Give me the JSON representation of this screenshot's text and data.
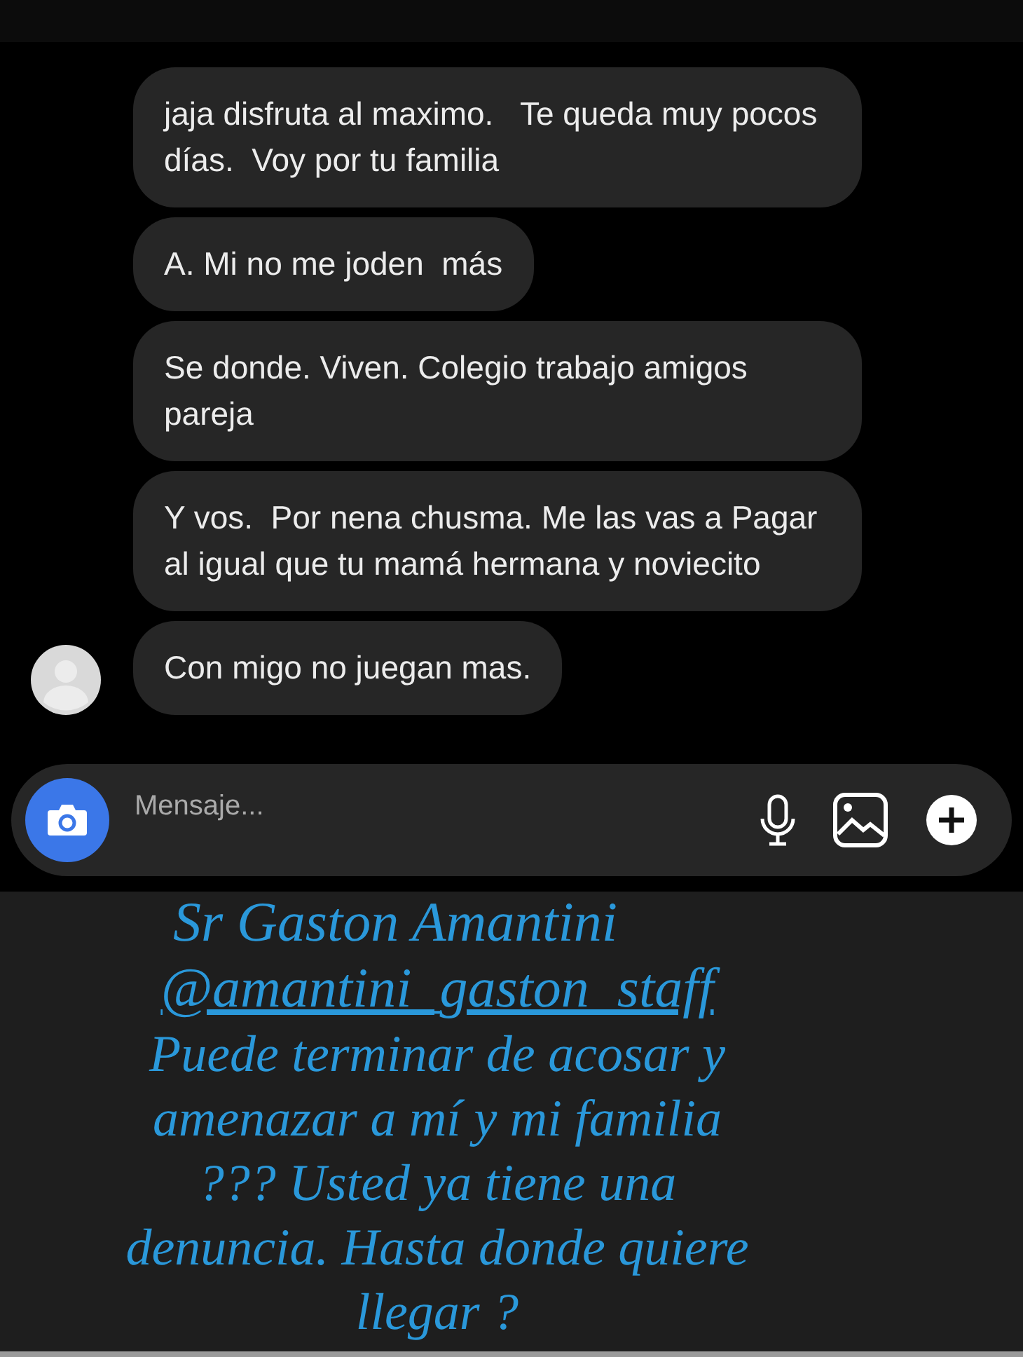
{
  "messages": [
    {
      "text": "jaja disfruta al maximo.   Te queda muy pocos días.  Voy por tu familia",
      "avatar": false
    },
    {
      "text": "A. Mi no me joden  más",
      "avatar": false
    },
    {
      "text": "Se donde. Viven. Colegio trabajo amigos pareja",
      "avatar": false
    },
    {
      "text": "Y vos.  Por nena chusma. Me las vas a Pagar al igual que tu mamá hermana y noviecito",
      "avatar": false
    },
    {
      "text": "Con migo no juegan mas.",
      "avatar": true
    }
  ],
  "composer": {
    "placeholder": "Mensaje..."
  },
  "story_text": {
    "title": "Sr Gaston Amantini",
    "handle": "@amantini_gaston_staff",
    "body": "Puede terminar de acosar y amenazar a mí y mi familia ??? Usted ya tiene una denuncia. Hasta donde quiere llegar ?"
  }
}
